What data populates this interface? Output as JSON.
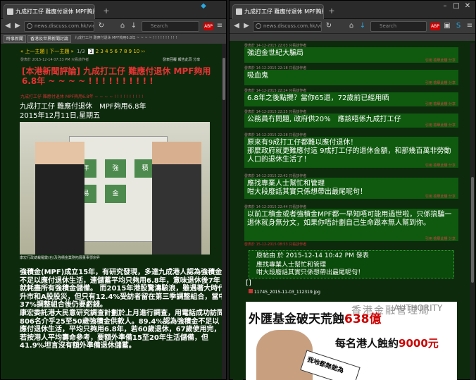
{
  "left": {
    "tab_title": "九成打工仔 難應付退休 MPF夠用...",
    "url": "news.discuss.com.hk/viewthread.p",
    "toolbar_links": [
      "時事新聞",
      "香港及世界新聞討論"
    ],
    "breadcrumb": "九成打工仔 難應付退休 MPF夠用6.8年 ~ ~ ~ ~ ! ! ! ! ! ! ! ! ! !",
    "pager": {
      "prev": "« 上一主題",
      "next": "下一主題 »",
      "pages": [
        "1",
        "2",
        "3",
        "4",
        "5",
        "6",
        "7",
        "8",
        "9",
        "10"
      ],
      "current": "1",
      "last": "››"
    },
    "post_buttons": [
      "發表回覆",
      "報告此頁",
      "分享"
    ],
    "post_meta": "發表於 2015-12-14 07:33 PM  只看該作者",
    "heading": "[本港新聞評論] 九成打工仔 難應付退休 MPF夠用6.8年 ~ ~ ~ ~ ! ! ! ! ! ! ! ! ! !",
    "subline": "九成打工仔 難應付退休 MPF夠用6.8年 ~ ~ ~ ~ ! ! ! ! ! ! ! ! ! !",
    "title_block": [
      "九成打工仔 難應付退休　MPF夠用6.8年",
      "2015年12月11日,星期五"
    ],
    "photo_caption": "康宏行政總裁羅鍵(右)及強積金業務拓展董事鄧宗昇",
    "photo_board": [
      "年",
      "強",
      "積",
      "易",
      "金"
    ],
    "body": "強積金(MPF)成立15年，有研究發現，多達九成港人認為強積金不足以應付退休生活，連儲蓄平均只夠用6.8年，意味退休後7年就耗盡所有強積金儲備。 而2015年港股驚濤駭浪，雖遇著大時代升市和A股股災，但只有12.4%受訪者留在第三季調整組合，當中37%調整組合後仍要虧錢。\n康宏委託港大民意研究調查計劃於上月進行調查，用電話成功訪問806名介乎25至50歲強積金供款人。89.4%認為強積金不足以應付退休生活，平均只夠用6.8年，若60歲退休，67歲使用完，若按港人平均壽命參考，要額外準備15至20年生活儲備，但41.9%坦言沒有額外準備退休儲蓄。"
  },
  "right": {
    "tab_title": "九成打工仔 難應付退休 MPF夠用...",
    "url": "news.discuss.com.hk/viewt",
    "replies": [
      {
        "meta": "發表於 14-12-2015 22:03  只看該作者",
        "text": "強迫金世紀大騙局",
        "action": "引用 檢舉此樓 分享"
      },
      {
        "meta": "發表於 14-12-2015 22:18  只看該作者",
        "text": "吸血鬼",
        "action": "引用 檢舉此樓 分享"
      },
      {
        "meta": "發表於 14-12-2015 22:24  只看該作者",
        "text": "6.8年之後點攪？當你65退，72歲前已經用晒",
        "action": "引用 檢舉此樓 分享"
      },
      {
        "meta": "發表於 14-12-2015 22:25  只看該作者",
        "text": "公務員冇問題, 政府供20%　應該唔係九成打工仔",
        "action": "引用 檢舉此樓 分享"
      },
      {
        "meta": "發表於 14-12-2015 22:28  只看該作者",
        "text": "原來有9成打工仔都難以應付退休！\n那麼政府就更難應付這 9成打工仔的退休金額，和那幾百萬非勞動人口的退休生活了！",
        "action": "引用 檢舉此樓 分享"
      },
      {
        "meta": "發表於 14-12-2015 22:42  只看該作者",
        "text": "應找專業人士幫忙和管理\n咁大段廢話其實只係想帶出最尾呢句！",
        "action": "引用 檢舉此樓 分享"
      },
      {
        "meta": "發表於 14-12-2015 22:44  只看該作者",
        "text": "以前工積金或者強積金MPF都一早知唔可能用過世啦，只係搞騙一退休就身無分文，如果你唔計劃自己生命跟本無人幫到你。",
        "action": "引用 檢舉此樓 分享"
      }
    ],
    "last_meta": "發表於 15-12-2015 08:53  只看該作者",
    "quote": {
      "header": "原帖由 於 2015-12-14 10:42 PM 發表",
      "lines": [
        "應找專業人士幫忙和管理",
        "咁大段廢話其實只係想帶出最尾呢句！"
      ]
    },
    "bracket": "[]",
    "attachment": "11745_2015-11-03_112319.jpg",
    "news_image": {
      "line1_prefix": "外匯基金破天荒蝕",
      "line1_value": "638億",
      "line2_prefix": "每名港人蝕約",
      "line2_value": "9000元",
      "sign": "香港金融管理局",
      "bubble": "我地都無能為",
      "sign_en": "AUTHORITY"
    }
  },
  "search_placeholder": "Search",
  "colors": {
    "bg": "#0d2a0d",
    "reply_bg": "#0f5a0f",
    "heading": "#e63333",
    "pager": "#ffcc00"
  }
}
